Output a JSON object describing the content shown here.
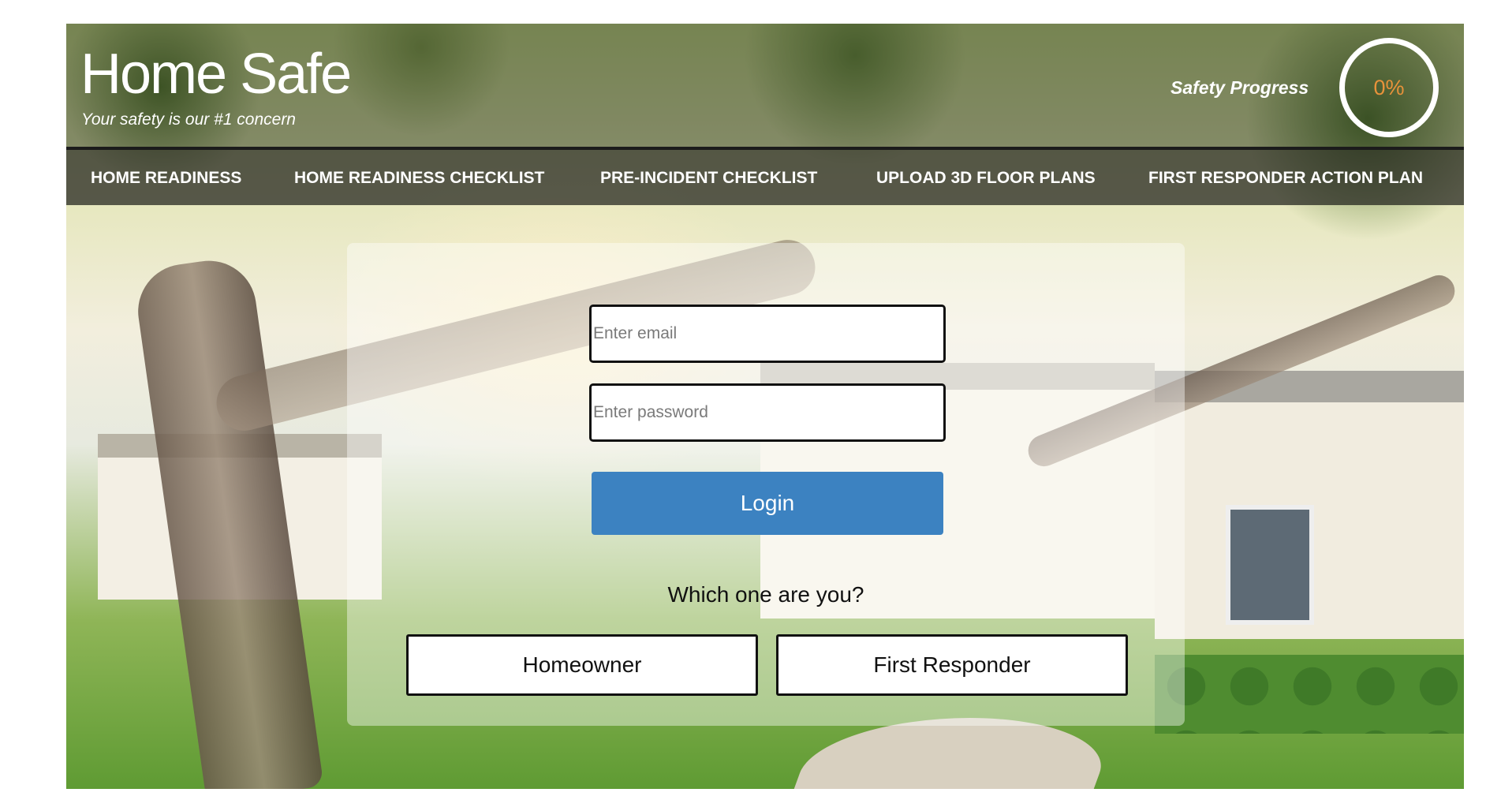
{
  "brand": {
    "title": "Home Safe",
    "subtitle": "Your safety is our #1 concern"
  },
  "progress": {
    "label": "Safety Progress",
    "value_text": "0%",
    "value": 0,
    "color": "#e8923a"
  },
  "nav": {
    "items": [
      {
        "label": "HOME READINESS"
      },
      {
        "label": "HOME READINESS CHECKLIST"
      },
      {
        "label": "PRE-INCIDENT CHECKLIST"
      },
      {
        "label": "UPLOAD 3D FLOOR PLANS"
      },
      {
        "label": "FIRST RESPONDER ACTION PLAN"
      }
    ]
  },
  "login": {
    "email_placeholder": "Enter email",
    "password_placeholder": "Enter password",
    "button_label": "Login",
    "button_color": "#3c82c1"
  },
  "role": {
    "question": "Which one are you?",
    "options": [
      {
        "label": "Homeowner"
      },
      {
        "label": "First Responder"
      }
    ]
  }
}
